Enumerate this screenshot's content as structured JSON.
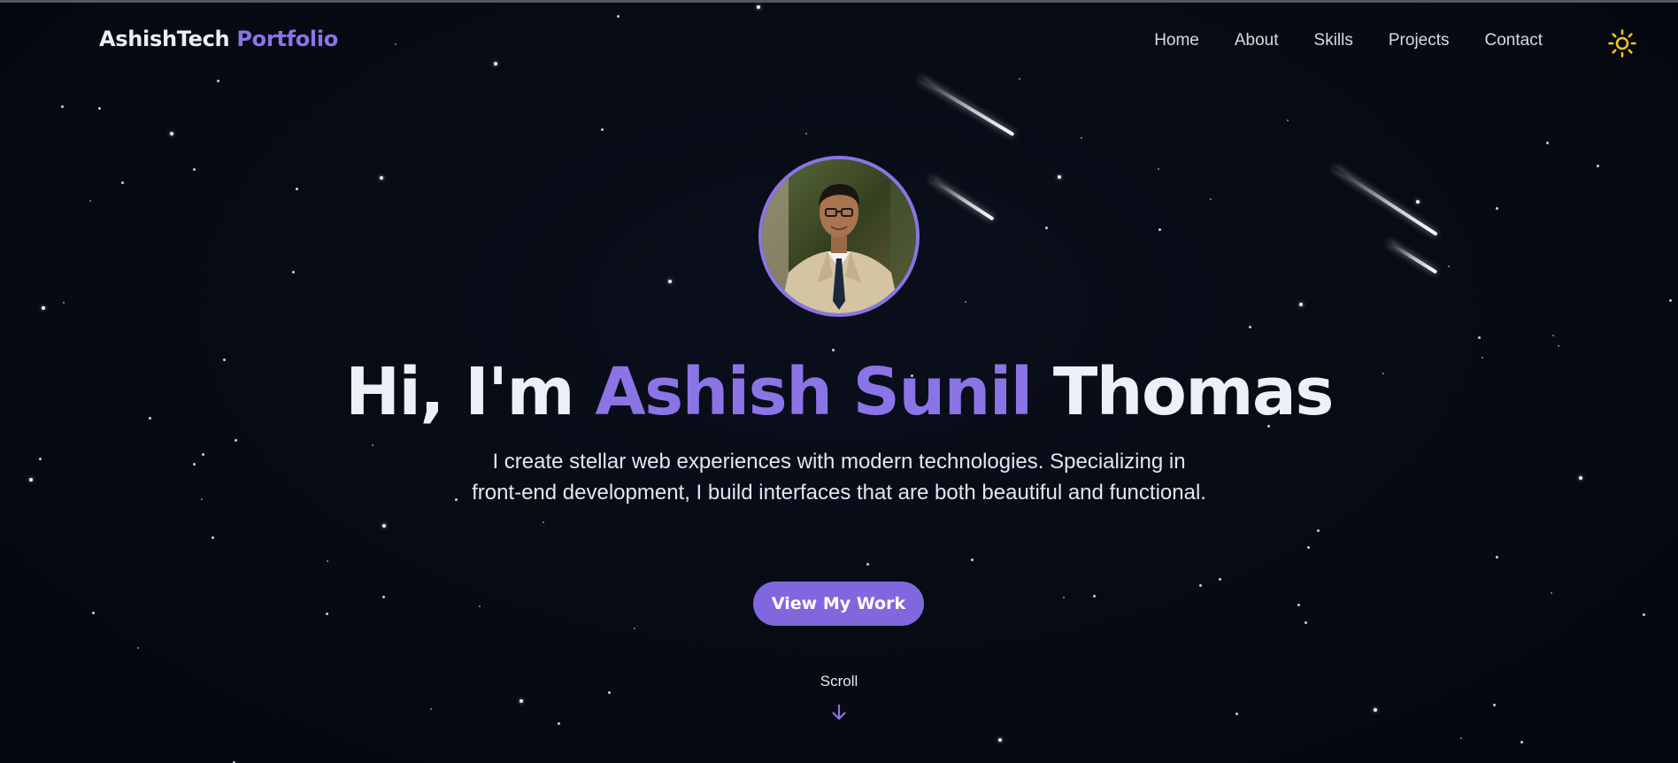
{
  "header": {
    "brand_primary": "AshishTech",
    "brand_accent": "Portfolio",
    "nav": [
      "Home",
      "About",
      "Skills",
      "Projects",
      "Contact"
    ],
    "theme_icon": "sun-icon"
  },
  "hero": {
    "avatar_alt": "Ashish Sunil Thomas",
    "greeting": "Hi, I'm ",
    "name_accent": "Ashish Sunil",
    "name_rest": " Thomas",
    "subtitle": "I create stellar web experiences with modern technologies. Specializing in front-end development, I build interfaces that are both beautiful and functional.",
    "cta_label": "View My Work",
    "scroll_label": "Scroll",
    "scroll_icon": "arrow-down-icon"
  },
  "colors": {
    "background": "#070a13",
    "accent": "#8b74e6",
    "button": "#7f68de",
    "sun": "#f5c518"
  }
}
